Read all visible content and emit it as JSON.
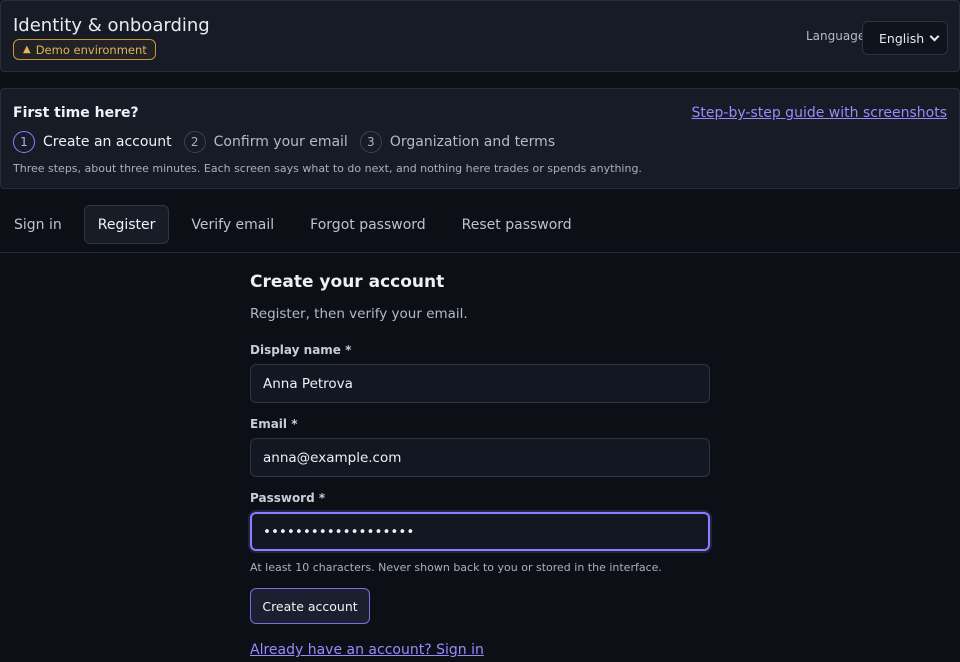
{
  "header": {
    "title": "Identity & onboarding",
    "badge": "Demo environment",
    "language_label": "Language",
    "language_value": "English"
  },
  "guide": {
    "title": "First time here?",
    "link": "Step-by-step guide with screenshots",
    "steps": [
      {
        "num": "1",
        "label": "Create an account",
        "active": true
      },
      {
        "num": "2",
        "label": "Confirm your email",
        "active": false
      },
      {
        "num": "3",
        "label": "Organization and terms",
        "active": false
      }
    ],
    "description": "Three steps, about three minutes. Each screen says what to do next, and nothing here trades or spends anything."
  },
  "tabs": [
    "Sign in",
    "Register",
    "Verify email",
    "Forgot password",
    "Reset password"
  ],
  "active_tab": "Register",
  "form": {
    "title": "Create your account",
    "subtitle": "Register, then verify your email.",
    "display_name_label": "Display name *",
    "display_name_value": "Anna Petrova",
    "email_label": "Email *",
    "email_value": "anna@example.com",
    "password_label": "Password *",
    "password_value": "•••••••••••••••••••",
    "password_hint": "At least 10 characters. Never shown back to you or stored in the interface.",
    "submit_label": "Create account",
    "signin_link": "Already have an account? Sign in"
  },
  "colors": {
    "accent": "#8d7dff",
    "warning": "#e4b25a",
    "background": "#0c0f16"
  },
  "icons": {
    "badge_icon": "warning-triangle-icon",
    "select_icon": "chevron-down-icon"
  }
}
